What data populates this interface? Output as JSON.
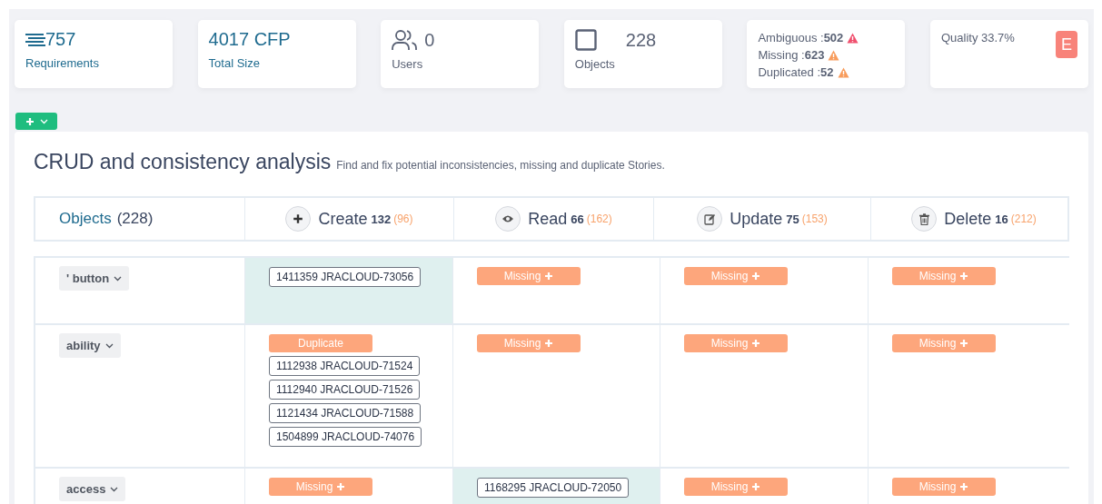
{
  "stats": [
    {
      "kind": "requirements",
      "value": "757",
      "label": "Requirements"
    },
    {
      "kind": "size",
      "value": "4017 CFP",
      "label": "Total Size"
    },
    {
      "kind": "users",
      "value": "0",
      "label": "Users"
    },
    {
      "kind": "objects",
      "value": "228",
      "label": "Objects"
    }
  ],
  "issues": [
    {
      "label": "Ambiguous :",
      "value": "502",
      "color": "#f0506e"
    },
    {
      "label": "Missing :",
      "value": "623",
      "color": "#f89c5c"
    },
    {
      "label": "Duplicated :",
      "value": "52",
      "color": "#f89c5c"
    }
  ],
  "quality": {
    "label": "Quality 33.7%",
    "grade": "E",
    "color": "#f8837a"
  },
  "analysis": {
    "title": "CRUD and consistency analysis",
    "subtitle": "Find and fix potential inconsistencies, missing and duplicate Stories.",
    "objects_header": {
      "label": "Objects",
      "count": "(228)"
    },
    "columns": [
      {
        "kind": "create",
        "label": "Create",
        "count": "132",
        "missing": "(96)"
      },
      {
        "kind": "read",
        "label": "Read",
        "count": "66",
        "missing": "(162)"
      },
      {
        "kind": "update",
        "label": "Update",
        "count": "75",
        "missing": "(153)"
      },
      {
        "kind": "delete",
        "label": "Delete",
        "count": "16",
        "missing": "(212)"
      }
    ],
    "rows": [
      {
        "object": "' button",
        "cells": [
          {
            "kind": "stories",
            "highlight": true,
            "stories": [
              "1411359 JRACLOUD-73056"
            ]
          },
          {
            "kind": "missing",
            "label": "Missing"
          },
          {
            "kind": "missing",
            "label": "Missing"
          },
          {
            "kind": "missing",
            "label": "Missing"
          }
        ]
      },
      {
        "object": "ability",
        "cells": [
          {
            "kind": "stories",
            "highlight": false,
            "badge": "Duplicate",
            "stories": [
              "1112938 JRACLOUD-71524",
              "1112940 JRACLOUD-71526",
              "1121434 JRACLOUD-71588",
              "1504899 JRACLOUD-74076"
            ]
          },
          {
            "kind": "missing",
            "label": "Missing"
          },
          {
            "kind": "missing",
            "label": "Missing"
          },
          {
            "kind": "missing",
            "label": "Missing"
          }
        ]
      },
      {
        "object": "access",
        "cells": [
          {
            "kind": "missing",
            "label": "Missing"
          },
          {
            "kind": "stories",
            "highlight": true,
            "stories": [
              "1168295 JRACLOUD-72050"
            ]
          },
          {
            "kind": "missing",
            "label": "Missing"
          },
          {
            "kind": "missing",
            "label": "Missing"
          }
        ]
      }
    ]
  }
}
